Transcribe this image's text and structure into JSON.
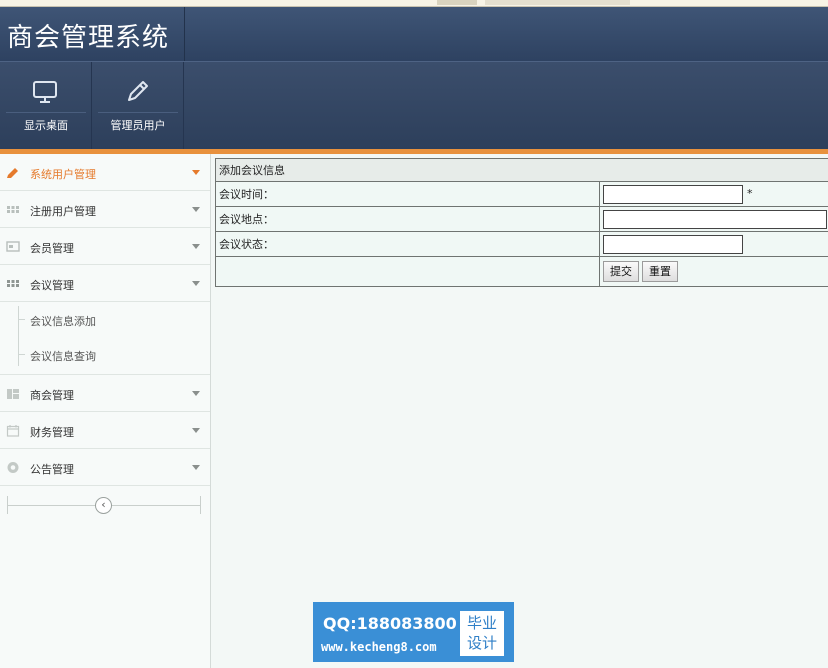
{
  "app": {
    "title": "商会管理系统"
  },
  "toolbar": {
    "buttons": [
      {
        "label": "显示桌面",
        "icon": "monitor-icon"
      },
      {
        "label": "管理员用户",
        "icon": "pencil-icon"
      }
    ]
  },
  "sidebar": {
    "items": [
      {
        "label": "系统用户管理",
        "icon": "pencil-icon",
        "active": true
      },
      {
        "label": "注册用户管理",
        "icon": "grid-icon"
      },
      {
        "label": "会员管理",
        "icon": "card-icon"
      },
      {
        "label": "会议管理",
        "icon": "grid-icon",
        "expanded": true
      },
      {
        "label": "商会管理",
        "icon": "layout-icon"
      },
      {
        "label": "财务管理",
        "icon": "calendar-icon"
      },
      {
        "label": "公告管理",
        "icon": "lifebuoy-icon"
      }
    ],
    "subitems": [
      {
        "label": "会议信息添加"
      },
      {
        "label": "会议信息查询"
      }
    ],
    "collapse_symbol": "‹"
  },
  "form": {
    "title": "添加会议信息",
    "fields": [
      {
        "label": "会议时间：",
        "value": "",
        "required_mark": "*"
      },
      {
        "label": "会议地点：",
        "value": ""
      },
      {
        "label": "会议状态：",
        "value": ""
      }
    ],
    "submit_label": "提交",
    "reset_label": "重置"
  },
  "watermark": {
    "qq": "QQ:188083800",
    "url": "www.kecheng8.com",
    "badge_line1": "毕业",
    "badge_line2": "设计"
  },
  "colors": {
    "header": "#34486a",
    "accent": "#e8913d",
    "active_text": "#e57a2c"
  }
}
